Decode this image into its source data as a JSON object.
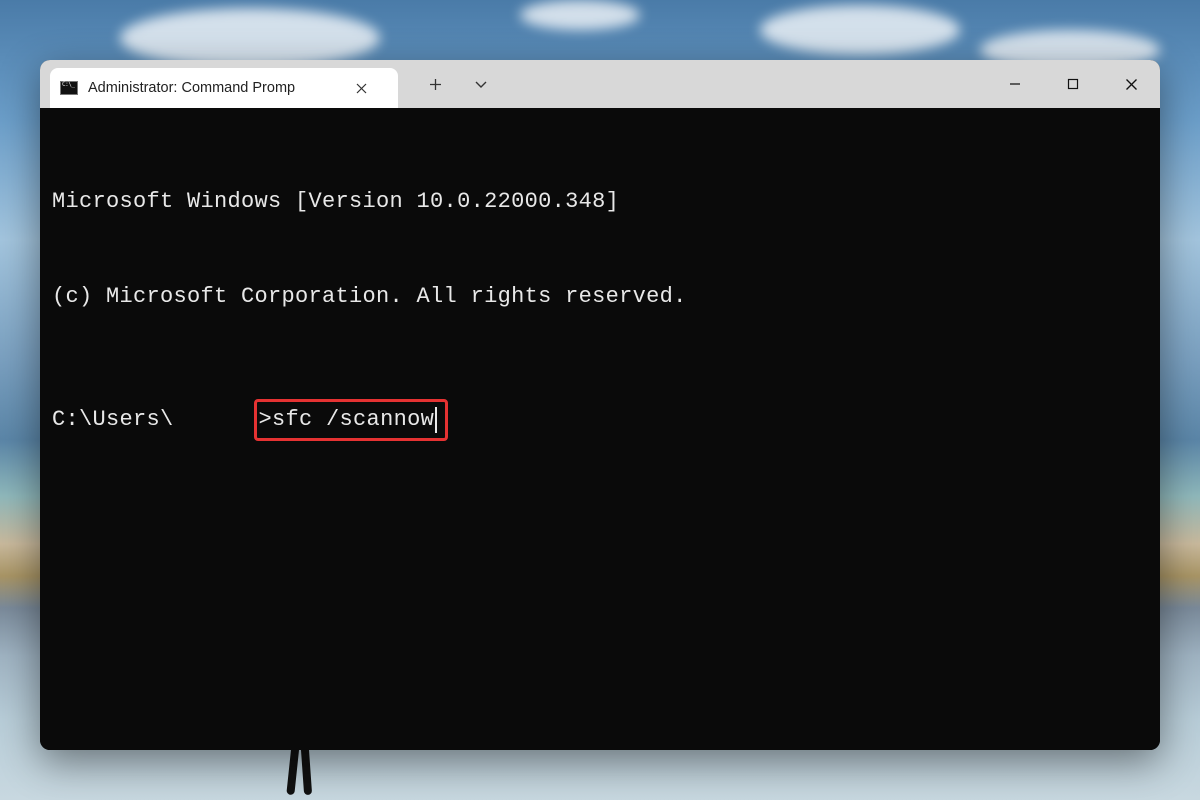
{
  "titlebar": {
    "tab_title": "Administrator: Command Promp"
  },
  "terminal": {
    "banner_line1": "Microsoft Windows [Version 10.0.22000.348]",
    "banner_line2": "(c) Microsoft Corporation. All rights reserved.",
    "prompt_prefix": "C:\\Users\\",
    "prompt_suffix": ">",
    "command": "sfc /scannow"
  },
  "colors": {
    "highlight_border": "#e53232",
    "terminal_bg": "#0a0a0a",
    "terminal_fg": "#e8e8e8",
    "titlebar_bg": "#d8d8d8",
    "active_tab_bg": "#ffffff"
  }
}
